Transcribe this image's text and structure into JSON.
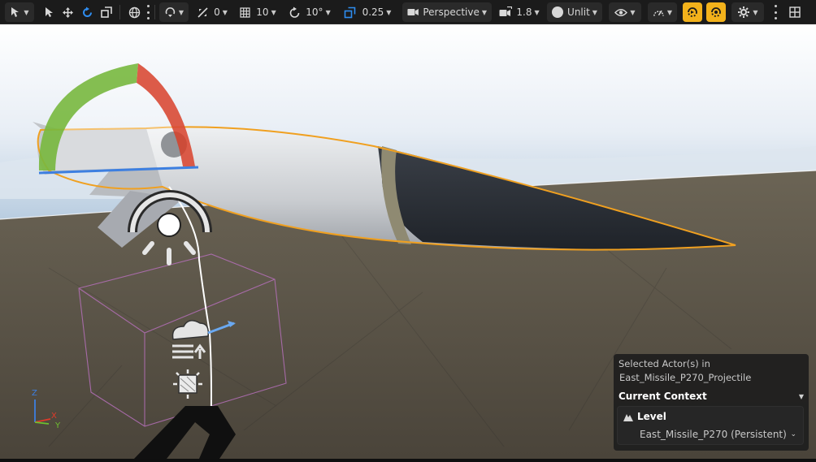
{
  "toolbar": {
    "grid_snap_value": "10",
    "rotation_snap_value": "10°",
    "scale_snap_value": "0.25",
    "translate_snap_value": "0",
    "view_mode_label": "Perspective",
    "camera_speed": "1.8",
    "lit_mode_label": "Unlit"
  },
  "context_panel": {
    "selected_line1": "Selected Actor(s) in",
    "selected_line2": "East_Missile_P270_Projectile",
    "current_context_label": "Current Context",
    "level_label": "Level",
    "level_name": "East_Missile_P270 (Persistent)"
  },
  "axis_gizmo": {
    "z": "Z",
    "x": "X",
    "y": "Y"
  },
  "colors": {
    "selection_outline": "#f0a020",
    "accent_yellow": "#f3b21b",
    "axis_x": "#e03a2a",
    "axis_y": "#6fc030",
    "axis_z": "#3d7fe0",
    "sky": "#c9d6e4",
    "ground": "#5c5548"
  }
}
